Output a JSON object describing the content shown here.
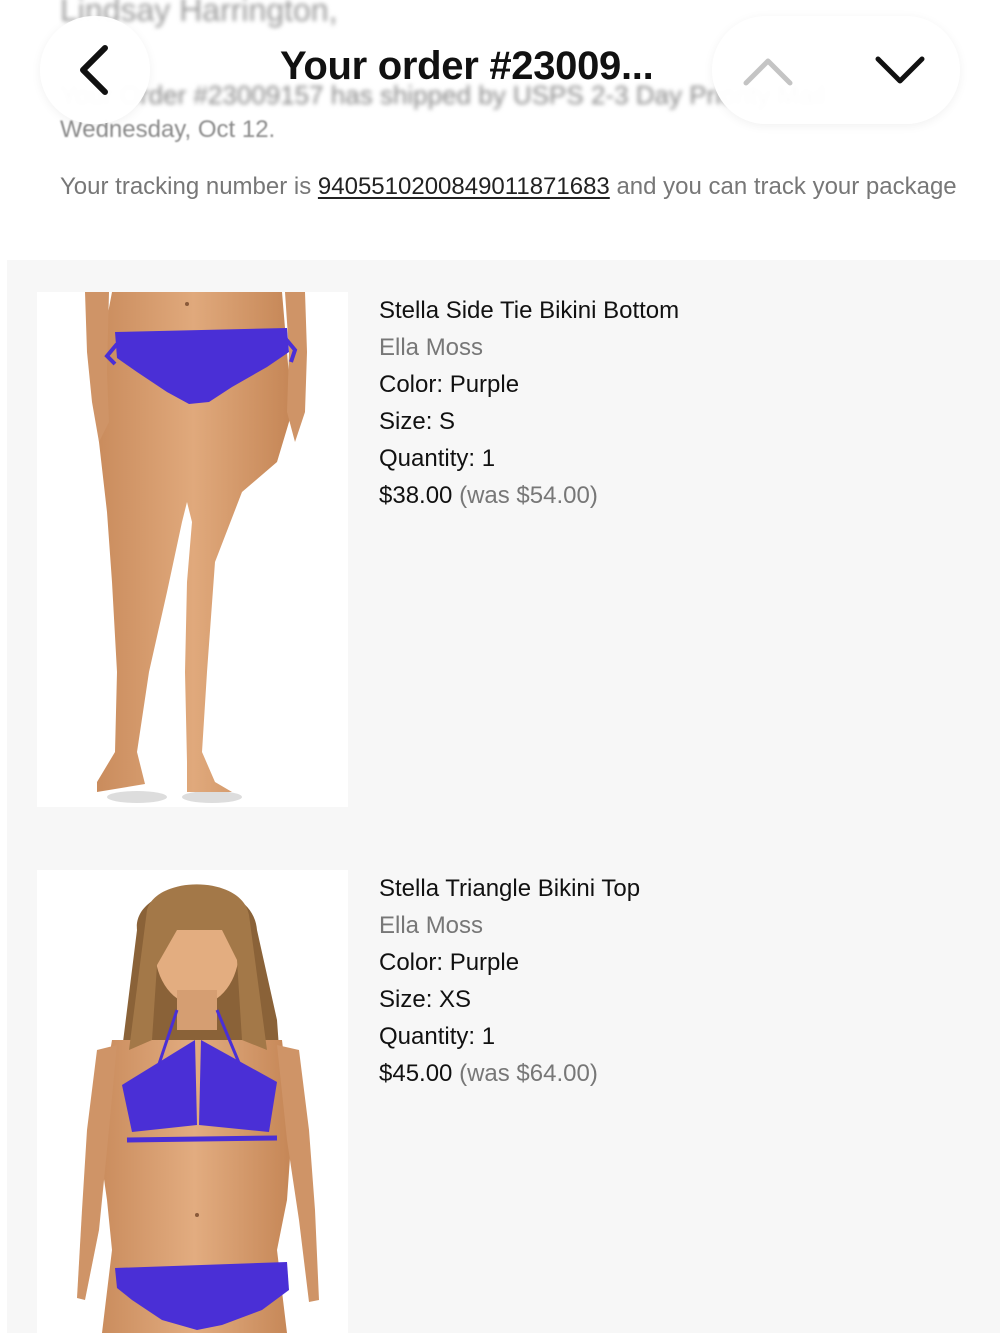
{
  "header": {
    "title": "Your order #23009...",
    "sender_name": "Lindsay Harrington,",
    "shipping_message": "Your Order #23009157 has shipped by USPS 2-3 Day Priority Mail",
    "date_line": "Wednesday, Oct 12.",
    "tracking_prefix": "Your tracking number is ",
    "tracking_number": "9405510200849011871683",
    "tracking_suffix": " and you can track your package"
  },
  "nav": {
    "back_icon": "chevron-left-icon",
    "up_icon": "chevron-up-icon",
    "down_icon": "chevron-down-icon"
  },
  "items": [
    {
      "name": "Stella Side Tie Bikini Bottom",
      "brand": "Ella Moss",
      "color": "Color: Purple",
      "size": "Size: S",
      "quantity": "Quantity: 1",
      "price": "$38.00",
      "was_price": "(was $54.00)"
    },
    {
      "name": "Stella Triangle Bikini Top",
      "brand": "Ella Moss",
      "color": "Color: Purple",
      "size": "Size: XS",
      "quantity": "Quantity: 1",
      "price": "$45.00",
      "was_price": "(was $64.00)"
    }
  ],
  "colors": {
    "panel_bg": "#f7f7f7",
    "muted_text": "#777777",
    "bikini_purple": "#4a2fd6",
    "skin_tone": "#d9a074"
  }
}
